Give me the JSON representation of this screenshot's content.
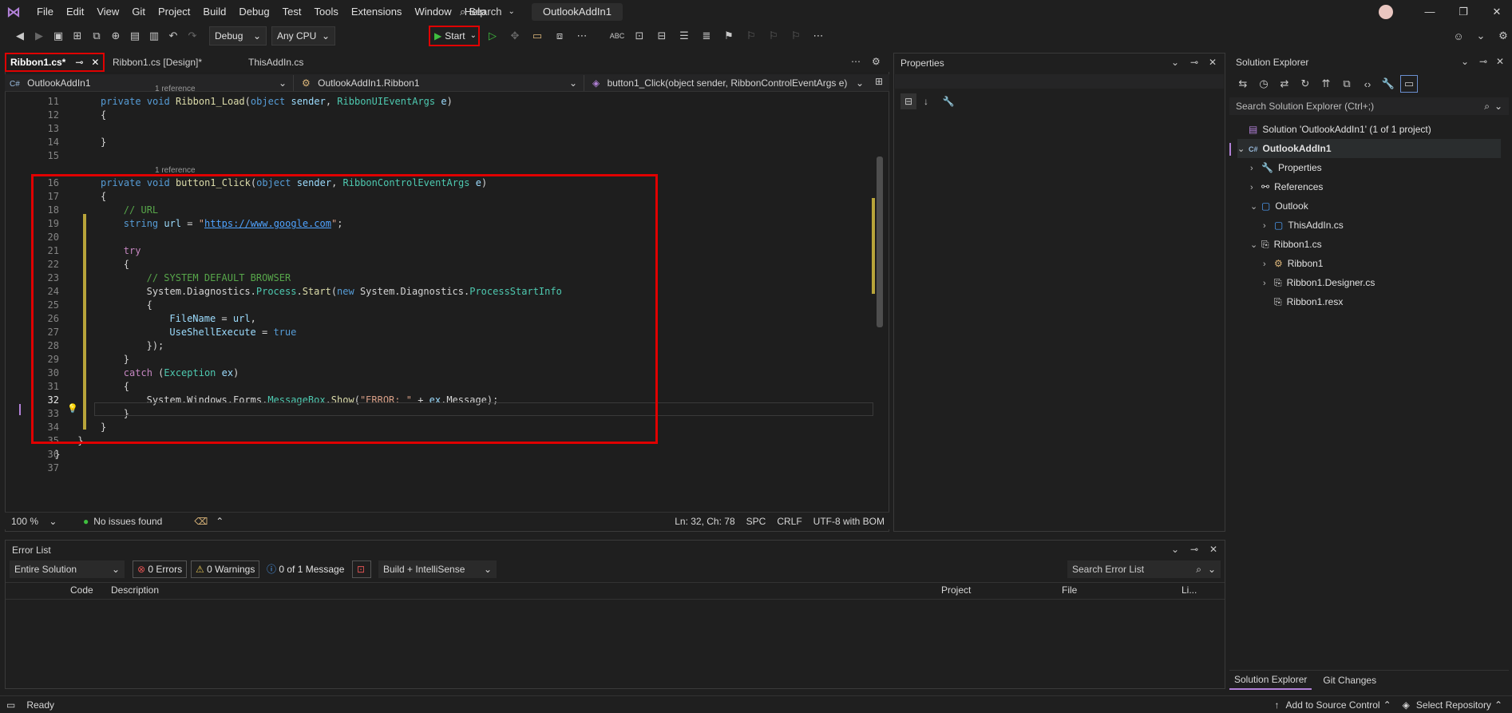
{
  "menu": {
    "items": [
      "File",
      "Edit",
      "View",
      "Git",
      "Project",
      "Build",
      "Debug",
      "Test",
      "Tools",
      "Extensions",
      "Window",
      "Help"
    ],
    "search_label": "Search",
    "solution_title": "OutlookAddIn1"
  },
  "toolbar": {
    "config": "Debug",
    "platform": "Any CPU",
    "start_label": "Start"
  },
  "tabs": [
    {
      "label": "Ribbon1.cs*",
      "active": true
    },
    {
      "label": "Ribbon1.cs [Design]*",
      "active": false
    },
    {
      "label": "ThisAddIn.cs",
      "active": false
    }
  ],
  "navbar": {
    "project": "OutlookAddIn1",
    "class": "OutlookAddIn1.Ribbon1",
    "member": "button1_Click(object sender, RibbonControlEventArgs e)"
  },
  "code": {
    "ref_label": "1 reference",
    "lines": [
      {
        "n": "11",
        "text": "private void Ribbon1_Load(object sender, RibbonUIEventArgs e)"
      },
      {
        "n": "12",
        "text": "{"
      },
      {
        "n": "13",
        "text": ""
      },
      {
        "n": "14",
        "text": "}"
      },
      {
        "n": "15",
        "text": ""
      },
      {
        "n": "16",
        "text": "private void button1_Click(object sender, RibbonControlEventArgs e)"
      },
      {
        "n": "17",
        "text": "{"
      },
      {
        "n": "18",
        "text": "// URL"
      },
      {
        "n": "19",
        "text": "string url = \"https://www.google.com\";"
      },
      {
        "n": "20",
        "text": ""
      },
      {
        "n": "21",
        "text": "try"
      },
      {
        "n": "22",
        "text": "{"
      },
      {
        "n": "23",
        "text": "// SYSTEM DEFAULT BROWSER"
      },
      {
        "n": "24",
        "text": "System.Diagnostics.Process.Start(new System.Diagnostics.ProcessStartInfo"
      },
      {
        "n": "25",
        "text": "{"
      },
      {
        "n": "26",
        "text": "FileName = url,"
      },
      {
        "n": "27",
        "text": "UseShellExecute = true"
      },
      {
        "n": "28",
        "text": "});"
      },
      {
        "n": "29",
        "text": "}"
      },
      {
        "n": "30",
        "text": "catch (Exception ex)"
      },
      {
        "n": "31",
        "text": "{"
      },
      {
        "n": "32",
        "text": "System.Windows.Forms.MessageBox.Show(\"ERROR: \" + ex.Message);"
      },
      {
        "n": "33",
        "text": "}"
      },
      {
        "n": "34",
        "text": "}"
      },
      {
        "n": "35",
        "text": "}"
      },
      {
        "n": "36",
        "text": "}"
      },
      {
        "n": "37",
        "text": ""
      }
    ]
  },
  "editor_status": {
    "zoom": "100 %",
    "issues": "No issues found",
    "position": "Ln: 32, Ch: 78",
    "indent": "SPC",
    "line_ending": "CRLF",
    "encoding": "UTF-8 with BOM"
  },
  "properties": {
    "title": "Properties"
  },
  "solution_explorer": {
    "title": "Solution Explorer",
    "search_placeholder": "Search Solution Explorer (Ctrl+;)",
    "solution": "Solution 'OutlookAddIn1' (1 of 1 project)",
    "project": "OutlookAddIn1",
    "properties": "Properties",
    "references": "References",
    "outlook": "Outlook",
    "thisaddin": "ThisAddIn.cs",
    "ribbon_cs": "Ribbon1.cs",
    "ribbon_class": "Ribbon1",
    "ribbon_designer": "Ribbon1.Designer.cs",
    "ribbon_resx": "Ribbon1.resx",
    "tab_solex": "Solution Explorer",
    "tab_git": "Git Changes"
  },
  "error_list": {
    "title": "Error List",
    "scope": "Entire Solution",
    "errors": "0 Errors",
    "warnings": "0 Warnings",
    "messages": "0 of 1 Message",
    "source": "Build + IntelliSense",
    "search_placeholder": "Search Error List",
    "col_code": "Code",
    "col_description": "Description",
    "col_project": "Project",
    "col_file": "File",
    "col_line": "Li..."
  },
  "status": {
    "ready": "Ready",
    "add_source": "Add to Source Control",
    "select_repo": "Select Repository"
  },
  "colors": {
    "highlight_border": "#e00000",
    "accent": "#b180d7",
    "keyword": "#569cd6",
    "type": "#4ec9b0",
    "comment": "#57a64a"
  }
}
